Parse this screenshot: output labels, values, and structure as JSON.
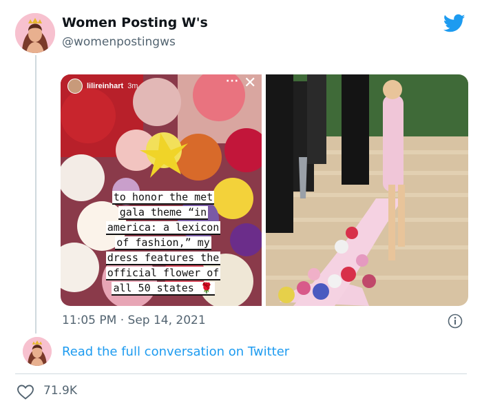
{
  "tweet": {
    "display_name": "Women Posting W's",
    "handle": "@womenpostingws",
    "timestamp": "11:05 PM · Sep 14, 2021",
    "read_more": "Read the full conversation on Twitter",
    "likes": "71.9K"
  },
  "story": {
    "username": "lilireinhart",
    "time": "3m",
    "menu": "···",
    "close": "✕",
    "caption_lines": [
      "to honor the met",
      "gala theme “in",
      "america: a lexicon",
      "of fashion,” my",
      "dress features the",
      "official flower of",
      "all 50 states 🌹"
    ]
  },
  "colors": {
    "twitter_blue": "#1d9bf0",
    "secondary_text": "#536471",
    "divider": "#cfd9de"
  },
  "icons": {
    "brand": "twitter-bird-icon",
    "info": "info-icon",
    "like": "heart-icon"
  }
}
